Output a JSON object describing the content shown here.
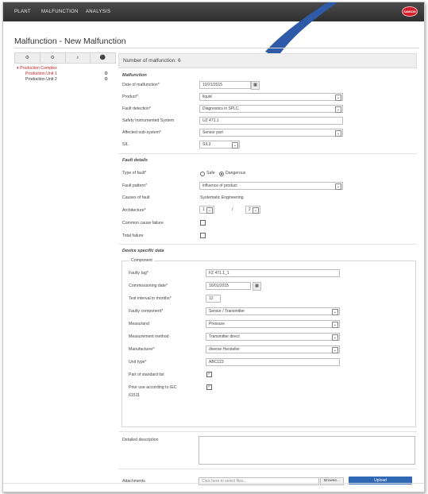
{
  "topbar": {
    "nav": [
      "PLANT",
      "MALFUNCTION",
      "ANALYSIS"
    ],
    "brand": "SAMSON",
    "accent": "#2e5aa8",
    "brand_color": "#d01f2a"
  },
  "page_title": "Malfunction - New Malfunction",
  "sidebar": {
    "tools": [
      "⚙",
      "⚙",
      "⌕",
      "⚫"
    ],
    "tree": {
      "root": "Production Complex",
      "children": [
        "Production Unit 1",
        "Production Unit 2"
      ]
    }
  },
  "main": {
    "number_label": "Number of malfunction: 6",
    "malfunction": {
      "title": "Malfunction",
      "date_label": "Date of malfunction*",
      "date_value": "10/21/2015",
      "product_label": "Product*",
      "product_value": "liquid",
      "fault_detection_label": "Fault detection*",
      "fault_detection_value": "Diagnostics in SPLC",
      "sis_label": "Safety Instrumented System",
      "sis_value": "UZ 471.1",
      "subsystem_label": "Affected sub-system*",
      "subsystem_value": "Sensor part",
      "sil_label": "SIL",
      "sil_value": "SIL3"
    },
    "fault_details": {
      "title": "Fault details",
      "type_label": "Type of fault*",
      "type_options": [
        "Safe",
        "Dangerous"
      ],
      "pattern_label": "Fault pattern*",
      "pattern_value": "influence of product",
      "cause_label": "Causes of fault",
      "cause_value": "Systematic Engineering",
      "architecture_label": "Architecture*",
      "arch_left": "1",
      "arch_sep": "/",
      "arch_right": "2",
      "ccf_label": "Common cause failure",
      "total_label": "Total failure"
    },
    "device": {
      "title": "Device specific data",
      "component_title": "Component",
      "faulty_tag_label": "Faulty tag*",
      "faulty_tag_value": "FZ 471.1_1",
      "commission_label": "Commissioning date*",
      "commission_value": "10/01/2015",
      "interval_label": "Test interval in months*",
      "interval_value": "12",
      "faulty_comp_label": "Faulty component*",
      "faulty_comp_value": "Sensor / Transmitter",
      "measurand_label": "Measurand",
      "measurand_value": "Pressure",
      "method_label": "Measurement method",
      "method_value": "Transmitter direct",
      "manufacturer_label": "Manufacturer*",
      "manufacturer_value": "diverse Hersteller",
      "unit_type_label": "Unit type*",
      "unit_type_value": "ABC123",
      "standard_label": "Part of standard list",
      "prior_use_label": "Prior use according to IEC",
      "prior_use_label2": "61511"
    },
    "detailed_label": "Detailed description",
    "attachments_label": "Attachments",
    "attachments_placeholder": "Click here to select files...",
    "browse_label": "Browse...",
    "upload_label": "Upload"
  }
}
